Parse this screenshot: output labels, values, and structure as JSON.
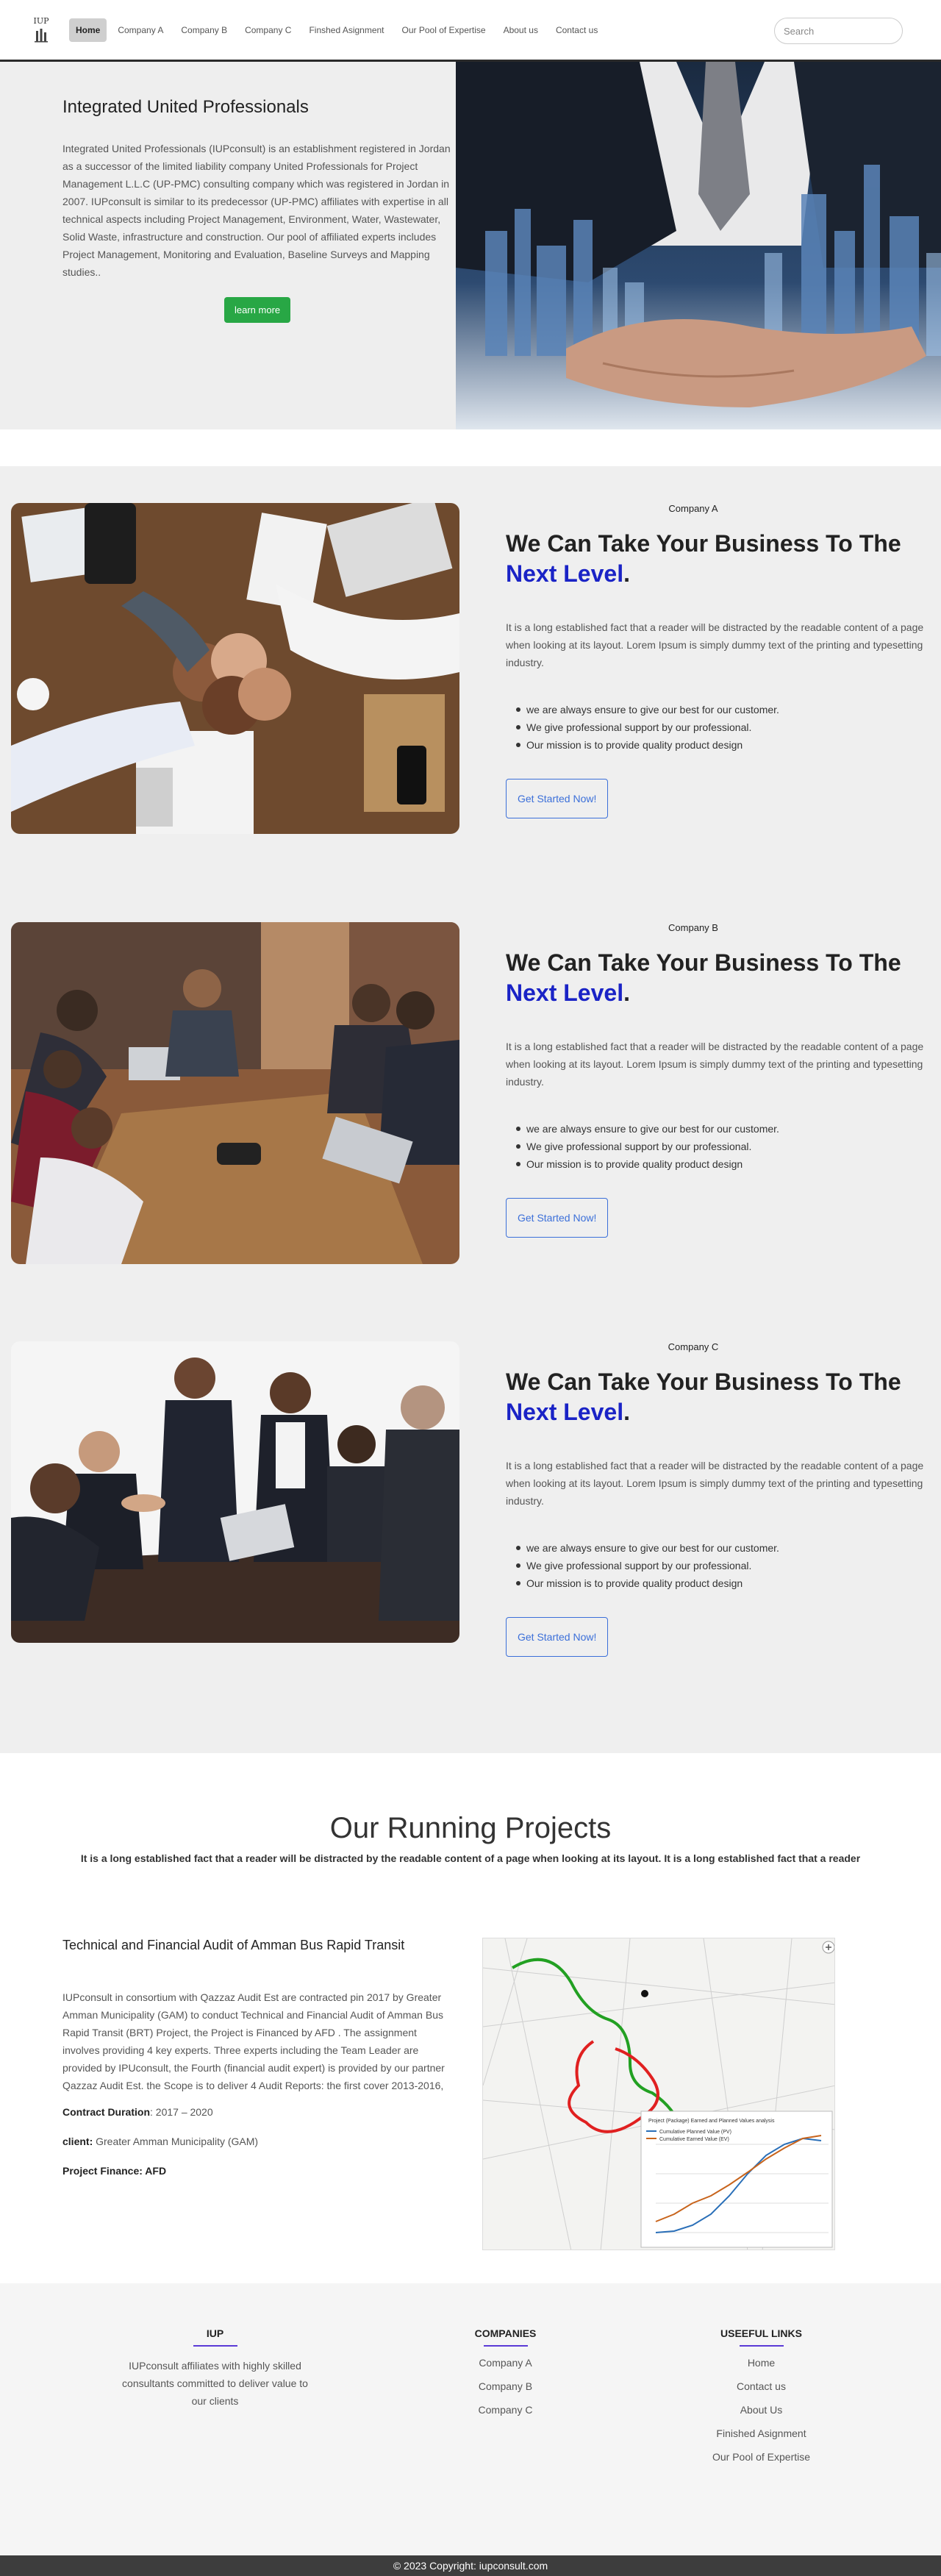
{
  "brand": {
    "logo_text": "IUP"
  },
  "nav": {
    "items": [
      {
        "label": "Home"
      },
      {
        "label": "Company A"
      },
      {
        "label": "Company B"
      },
      {
        "label": "Company C"
      },
      {
        "label": "Finshed Asignment"
      },
      {
        "label": "Our Pool of Expertise"
      },
      {
        "label": "About us"
      },
      {
        "label": "Contact us"
      }
    ],
    "search_placeholder": "Search"
  },
  "hero": {
    "title": "Integrated United Professionals",
    "body": "Integrated United Professionals (IUPconsult) is an establishment registered in Jordan as a successor of the limited liability company United Professionals for Project Management L.L.C (UP-PMC) consulting company which was registered in Jordan in 2007. IUPconsult is similar to its predecessor (UP-PMC) affiliates with expertise in all technical aspects including Project Management, Environment, Water, Wastewater, Solid Waste, infrastructure and construction. Our pool of affiliated experts includes Project Management, Monitoring and Evaluation, Baseline Surveys and Mapping studies..",
    "button": "learn more"
  },
  "companies": [
    {
      "name": "Company A",
      "headline": "We Can Take Your Business To The",
      "accent": "Next Level",
      "dot": ".",
      "body": "It is a long established fact that a reader will be distracted by the readable content of a page when looking at its layout. Lorem Ipsum is simply dummy text of the printing and typesetting industry.",
      "bullets": [
        "we are always ensure to give our best for our customer.",
        "We give professional support by our professional.",
        "Our mission is to provide quality product design"
      ],
      "button": "Get Started Now!"
    },
    {
      "name": "Company B",
      "headline": "We Can Take Your Business To The",
      "accent": "Next Level",
      "dot": ".",
      "body": "It is a long established fact that a reader will be distracted by the readable content of a page when looking at its layout. Lorem Ipsum is simply dummy text of the printing and typesetting industry.",
      "bullets": [
        "we are always ensure to give our best for our customer.",
        "We give professional support by our professional.",
        "Our mission is to provide quality product design"
      ],
      "button": "Get Started Now!"
    },
    {
      "name": "Company C",
      "headline": "We Can Take Your Business To The",
      "accent": "Next Level",
      "dot": ".",
      "body": "It is a long established fact that a reader will be distracted by the readable content of a page when looking at its layout. Lorem Ipsum is simply dummy text of the printing and typesetting industry.",
      "bullets": [
        "we are always ensure to give our best for our customer.",
        "We give professional support by our professional.",
        "Our mission is to provide quality product design"
      ],
      "button": "Get Started Now!"
    }
  ],
  "projects": {
    "title": "Our Running Projects",
    "subtitle": "It is a long established fact that a reader will be distracted by the readable content of a page when looking at its layout. It is a long established fact that a reader",
    "item": {
      "title": "Technical and Financial Audit of Amman Bus Rapid Transit",
      "body": "IUPconsult in consortium with Qazzaz Audit Est are contracted pin 2017 by Greater Amman Municipality (GAM) to conduct Technical and Financial Audit of Amman Bus Rapid Transit (BRT) Project, the Project is Financed by AFD . The assignment involves providing 4 key experts. Three experts including the Team Leader are provided by IPUconsult, the Fourth (financial audit expert) is provided by our partner Qazzaz Audit Est. the Scope is to deliver 4 Audit Reports: the first cover 2013-2016,",
      "duration_label": "Contract Duration",
      "duration_value": ": 2017 – 2020",
      "client_label": "client:",
      "client_value": " Greater Amman Municipality (GAM)",
      "finance": "Project Finance: AFD",
      "chart_title": "Project (Package) Earned and Planned Values analysis",
      "legend_pv": "Cumulative Planned Value (PV)",
      "legend_ev": "Cumulative Earned Value (EV)"
    }
  },
  "footer": {
    "col1": {
      "title": "IUP",
      "text": "IUPconsult affiliates with highly skilled consultants committed to deliver value to our clients"
    },
    "col2": {
      "title": "COMPANIES",
      "links": [
        "Company A",
        "Company B",
        "Company C"
      ]
    },
    "col3": {
      "title": "USEEFUL LINKS",
      "links": [
        "Home",
        "Contact us",
        "About Us",
        "Finished Asignment",
        "Our Pool of Expertise"
      ]
    },
    "copyright": "© 2023 Copyright: iupconsult.com"
  },
  "colors": {
    "accent": "#1a23c6",
    "green": "#28a745",
    "outline": "#3b6fd9",
    "footer_line": "#5b3bd6"
  }
}
